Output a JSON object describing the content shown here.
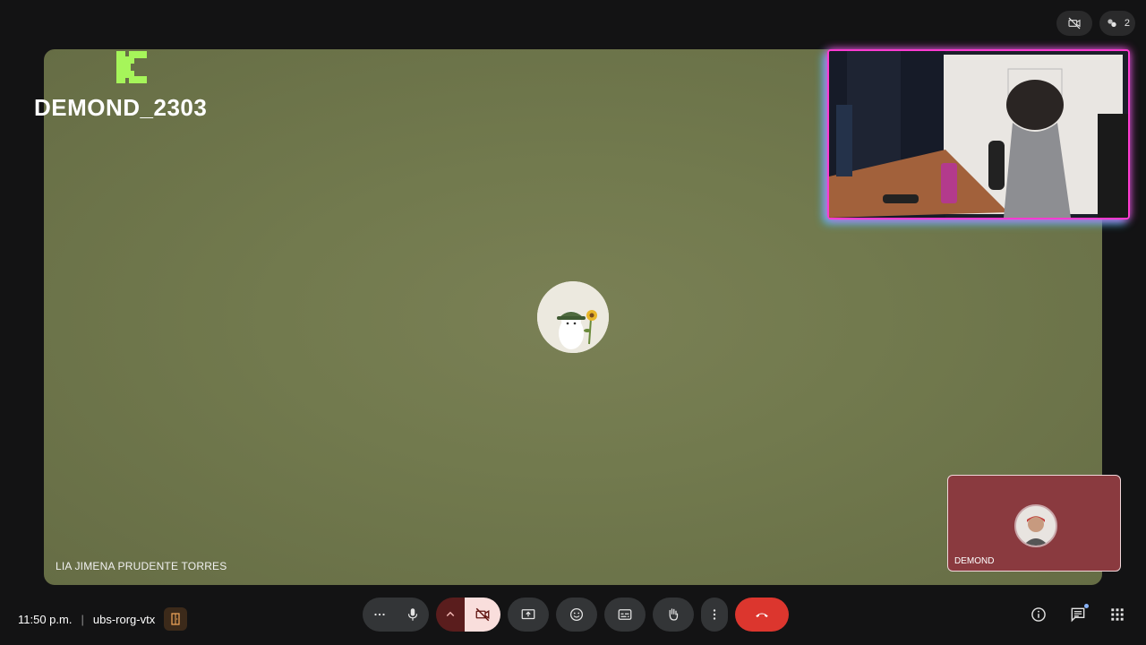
{
  "top": {
    "participants_count": "2"
  },
  "stage": {
    "overlay_brand": "DEMOND_2303",
    "main_participant": "LIA JIMENA PRUDENTE TORRES"
  },
  "self_tile": {
    "name": "DEMOND"
  },
  "footer": {
    "time": "11:50 p.m.",
    "meeting_code": "ubs-rorg-vtx"
  },
  "colors": {
    "accent_end_call": "#dc362e",
    "stage_bg": "#727a4e",
    "self_tile_bg": "#8a3a3f",
    "brand_logo": "#a6f55a",
    "webcam_border_pink": "#ff3bd1",
    "webcam_border_cyan": "#3bd1ff"
  },
  "icons": {
    "top": [
      "camera-off-icon",
      "people-icon"
    ],
    "controls": [
      "more-options-icon",
      "microphone-icon",
      "chevron-up-icon",
      "camera-off-icon",
      "present-screen-icon",
      "emoji-icon",
      "captions-icon",
      "raise-hand-icon",
      "more-vert-icon",
      "end-call-icon"
    ],
    "right": [
      "info-icon",
      "chat-icon",
      "apps-grid-icon"
    ]
  }
}
